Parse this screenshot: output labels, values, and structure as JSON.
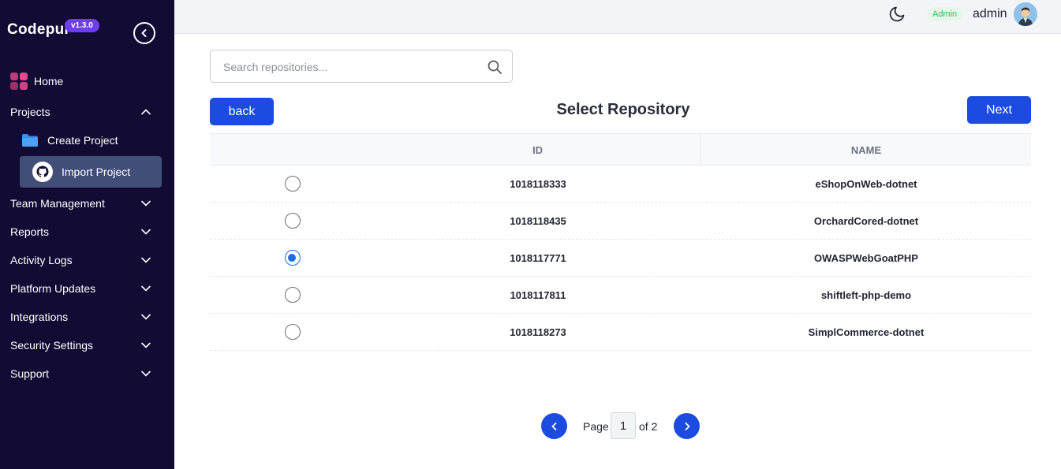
{
  "app": {
    "logo_text": "Codepul",
    "version": "v1.3.0"
  },
  "sidebar": {
    "home": "Home",
    "projects": "Projects",
    "create_project": "Create Project",
    "import_project": "Import Project",
    "team_management": "Team Management",
    "reports": "Reports",
    "activity_logs": "Activity Logs",
    "platform_updates": "Platform Updates",
    "integrations": "Integrations",
    "security_settings": "Security Settings",
    "support": "Support"
  },
  "topbar": {
    "role": "Admin",
    "username": "admin"
  },
  "search": {
    "placeholder": "Search repositories..."
  },
  "main": {
    "back_label": "back",
    "next_label": "Next",
    "title": "Select Repository"
  },
  "table": {
    "headers": {
      "id": "ID",
      "name": "NAME"
    },
    "rows": [
      {
        "id": "1018118333",
        "name": "eShopOnWeb-dotnet",
        "selected": false
      },
      {
        "id": "1018118435",
        "name": "OrchardCored-dotnet",
        "selected": false
      },
      {
        "id": "1018117771",
        "name": "OWASPWebGoatPHP",
        "selected": true
      },
      {
        "id": "1018117811",
        "name": "shiftleft-php-demo",
        "selected": false
      },
      {
        "id": "1018118273",
        "name": "SimplCommerce-dotnet",
        "selected": false
      }
    ]
  },
  "pagination": {
    "page_label": "Page",
    "current": "1",
    "of_label": "of 2"
  },
  "colors": {
    "sidebar_bg": "#120c35",
    "accent": "#1b4bdf",
    "radio_checked": "#1b6fe0",
    "active_item_bg": "#414e78"
  }
}
